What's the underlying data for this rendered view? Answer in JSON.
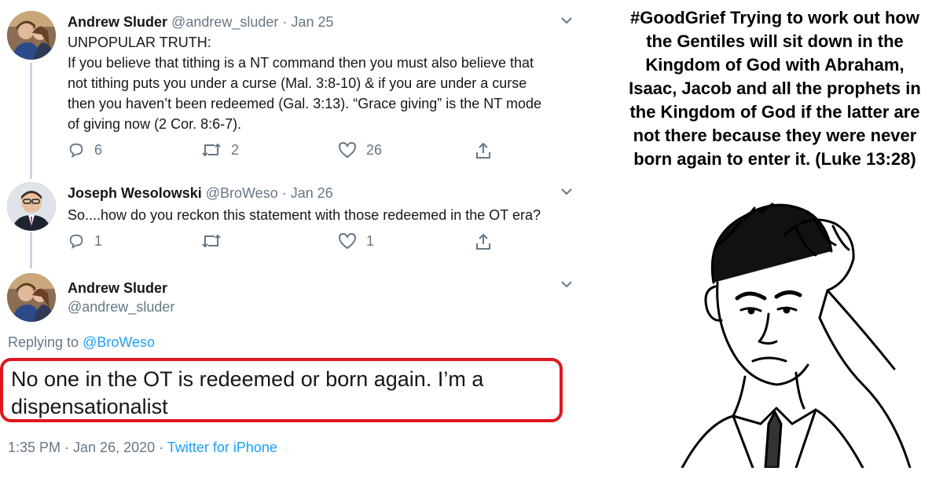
{
  "thread": {
    "tweets": [
      {
        "name": "Andrew Sluder",
        "handle": "@andrew_sluder",
        "sep": "·",
        "date": "Jan 25",
        "lines": [
          "UNPOPULAR TRUTH:",
          "If you believe that tithing is a NT command then you must also believe that",
          "not tithing puts you under a curse (Mal. 3:8-10) & if you are under a curse",
          "then you haven’t been redeemed (Gal. 3:13). “Grace giving” is the NT mode",
          "of giving now (2 Cor. 8:6-7)."
        ],
        "replies": "6",
        "retweets": "2",
        "likes": "26"
      },
      {
        "name": "Joseph Wesolowski",
        "handle": "@BroWeso",
        "sep": "·",
        "date": "Jan 26",
        "lines": [
          "So....how do you reckon this statement with those redeemed in the OT era?"
        ],
        "replies": "1",
        "retweets": "",
        "likes": "1"
      }
    ],
    "main": {
      "name": "Andrew Sluder",
      "handle": "@andrew_sluder",
      "replying_prefix": "Replying to",
      "replying_to": "@BroWeso",
      "text_line1": "No one in the OT is redeemed or born again. I’m a",
      "text_line2": "dispensationalist",
      "timestamp": "1:35 PM · Jan 26, 2020 ·",
      "client": "Twitter for iPhone"
    }
  },
  "caption": {
    "lines": [
      "#GoodGrief Trying to work out how",
      "the Gentiles will sit down in the",
      "Kingdom of God with Abraham,",
      "Isaac, Jacob and all the prophets in",
      "the Kingdom of God if the latter are",
      "not there because they were never",
      "born again to enter it. (Luke 13:28)"
    ]
  },
  "colors": {
    "text": "#14171a",
    "muted": "#657786",
    "link": "#1da1f2",
    "highlight_border": "#e0161e",
    "thread_line": "#ccd6dd"
  },
  "icons": [
    "reply-icon",
    "retweet-icon",
    "like-icon",
    "share-icon",
    "chevron-down-icon",
    "worried-man-illustration"
  ]
}
